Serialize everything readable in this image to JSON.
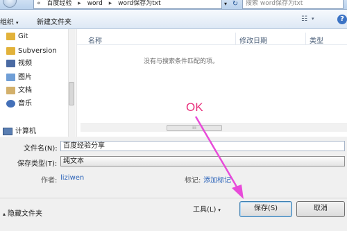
{
  "address_bar": {
    "path": [
      "百度经验",
      "word",
      "word保存为txt"
    ],
    "search_placeholder": "搜索 word保存为txt"
  },
  "toolbar": {
    "organize_label": "组织",
    "new_folder_label": "新建文件夹"
  },
  "nav": {
    "items": [
      {
        "label": "Git",
        "icon": "folder-icon",
        "color": "#e2b23a"
      },
      {
        "label": "Subversion",
        "icon": "folder-icon",
        "color": "#e2b23a"
      },
      {
        "label": "视频",
        "icon": "video-library-icon",
        "color": "#4a6aa3"
      },
      {
        "label": "图片",
        "icon": "pictures-library-icon",
        "color": "#6f9ed6"
      },
      {
        "label": "文档",
        "icon": "documents-library-icon",
        "color": "#d3b06b"
      },
      {
        "label": "音乐",
        "icon": "music-library-icon",
        "color": "#4470b8"
      }
    ],
    "computer_label": "计算机"
  },
  "file_list": {
    "columns": [
      "名称",
      "修改日期",
      "类型"
    ],
    "empty_message": "没有与搜索条件匹配的项。"
  },
  "form": {
    "filename_label": "文件名(N):",
    "filename_value": "百度经验分享",
    "filetype_label": "保存类型(T):",
    "filetype_value": "纯文本",
    "author_label": "作者:",
    "author_value": "liziwen",
    "tags_label": "标记:",
    "tags_value": "添加标记"
  },
  "footer": {
    "hide_folders_label": "隐藏文件夹",
    "tools_label": "工具(L)",
    "save_label": "保存(S)",
    "cancel_label": "取消"
  },
  "annotation": {
    "ok_text": "OK",
    "color": "#e8307c"
  }
}
